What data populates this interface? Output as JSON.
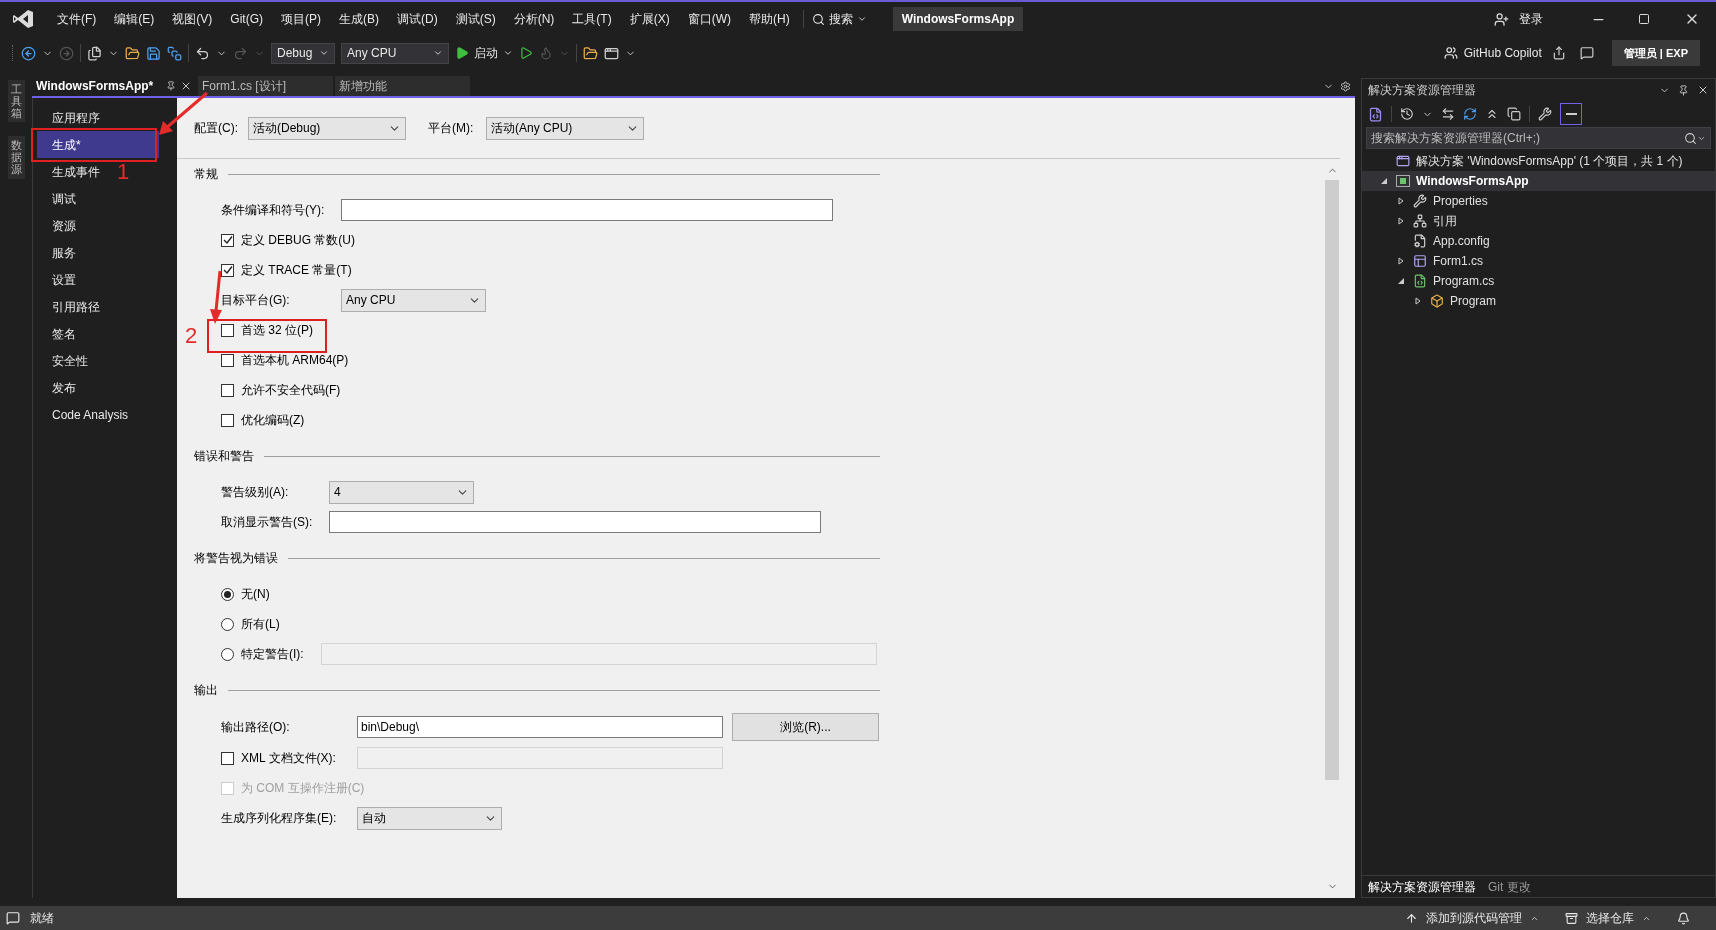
{
  "title_bar": {
    "menu": [
      "文件(F)",
      "编辑(E)",
      "视图(V)",
      "Git(G)",
      "项目(P)",
      "生成(B)",
      "调试(D)",
      "测试(S)",
      "分析(N)",
      "工具(T)",
      "扩展(X)",
      "窗口(W)",
      "帮助(H)"
    ],
    "search": "搜索",
    "solution": "WindowsFormsApp",
    "account": "登录"
  },
  "toolbar": {
    "configuration": "Debug",
    "platform": "Any CPU",
    "start": "启动",
    "copilot": "GitHub Copilot",
    "account_badge": "管理员 | EXP"
  },
  "side_tabs": [
    "工具箱",
    "数据源"
  ],
  "doc_tabs": [
    {
      "label": "WindowsFormsApp*",
      "selected": true
    },
    {
      "label": "Form1.cs [设计]",
      "selected": false
    },
    {
      "label": "新增功能",
      "selected": false
    }
  ],
  "nav": [
    {
      "label": "应用程序",
      "selected": false
    },
    {
      "label": "生成*",
      "selected": true,
      "callout": "1"
    },
    {
      "label": "生成事件",
      "selected": false
    },
    {
      "label": "调试",
      "selected": false
    },
    {
      "label": "资源",
      "selected": false
    },
    {
      "label": "服务",
      "selected": false
    },
    {
      "label": "设置",
      "selected": false
    },
    {
      "label": "引用路径",
      "selected": false
    },
    {
      "label": "签名",
      "selected": false
    },
    {
      "label": "安全性",
      "selected": false
    },
    {
      "label": "发布",
      "selected": false
    },
    {
      "label": "Code Analysis",
      "selected": false
    }
  ],
  "config": {
    "configuration_label": "配置(C):",
    "configuration": "活动(Debug)",
    "platform_label": "平台(M):",
    "platform": "活动(Any CPU)"
  },
  "sections": [
    {
      "title": "常规",
      "rows": [
        {
          "kind": "text",
          "label": "条件编译和符号(Y):"
        },
        {
          "kind": "checkbox",
          "label": "定义 DEBUG 常数(U)",
          "checked": true,
          "disabled": false
        },
        {
          "kind": "checkbox",
          "label": "定义 TRACE 常量(T)",
          "checked": true,
          "disabled": false
        },
        {
          "kind": "select",
          "label": "目标平台(G):",
          "value": "Any CPU"
        },
        {
          "kind": "checkbox",
          "label": "首选 32 位(P)",
          "checked": false,
          "disabled": false,
          "callout": "2"
        },
        {
          "kind": "checkbox",
          "label": "首选本机 ARM64(P)",
          "checked": false,
          "disabled": false
        },
        {
          "kind": "checkbox",
          "label": "允许不安全代码(F)",
          "checked": false,
          "disabled": false
        },
        {
          "kind": "checkbox",
          "label": "优化编码(Z)",
          "checked": false,
          "disabled": false
        }
      ]
    },
    {
      "title": "错误和警告",
      "rows": [
        {
          "kind": "select",
          "label": "警告级别(A):",
          "value": "4"
        },
        {
          "kind": "text",
          "label": "取消显示警告(S):"
        }
      ]
    },
    {
      "title": "将警告视为错误",
      "rows": [
        {
          "kind": "radio",
          "label": "无(N)",
          "selected": true
        },
        {
          "kind": "radio",
          "label": "所有(L)",
          "selected": false
        },
        {
          "kind": "radio_field",
          "label": "特定警告(I):",
          "selected": false
        }
      ]
    },
    {
      "title": "输出",
      "rows": [
        {
          "kind": "path",
          "label": "输出路径(O):",
          "value": "bin\\Debug\\",
          "button": "浏览(R)..."
        },
        {
          "kind": "checkbox_field",
          "label": "XML 文档文件(X):",
          "checked": false,
          "disabled": false
        },
        {
          "kind": "checkbox",
          "label": "为 COM 互操作注册(C)",
          "checked": false,
          "disabled": true
        },
        {
          "kind": "select",
          "label": "生成序列化程序集(E):",
          "value": "自动"
        }
      ]
    }
  ],
  "explorer": {
    "title": "解决方案资源管理器",
    "search_placeholder": "搜索解决方案资源管理器(Ctrl+;)",
    "tree": [
      {
        "label": "解决方案 'WindowsFormsApp' (1 个项目，共 1 个)",
        "kind": "solution",
        "selected": false,
        "children": [
          {
            "label": "WindowsFormsApp",
            "kind": "project",
            "selected": true,
            "expanded": true,
            "children": [
              {
                "label": "Properties",
                "kind": "wrench",
                "selected": false,
                "expanded": false
              },
              {
                "label": "引用",
                "kind": "references",
                "selected": false,
                "expanded": false
              },
              {
                "label": "App.config",
                "kind": "config",
                "selected": false
              },
              {
                "label": "Form1.cs",
                "kind": "form",
                "selected": false,
                "expanded": false
              },
              {
                "label": "Program.cs",
                "kind": "csharp",
                "selected": false,
                "expanded": true,
                "children": [
                  {
                    "label": "Program",
                    "kind": "class",
                    "selected": false,
                    "expanded": false
                  }
                ]
              }
            ]
          }
        ]
      }
    ],
    "bottom_tabs": [
      {
        "label": "解决方案资源管理器",
        "selected": true
      },
      {
        "label": "Git 更改",
        "selected": false
      }
    ]
  },
  "status_bar": {
    "message": "就绪",
    "source_control": "添加到源代码管理",
    "repository": "选择仓库"
  }
}
